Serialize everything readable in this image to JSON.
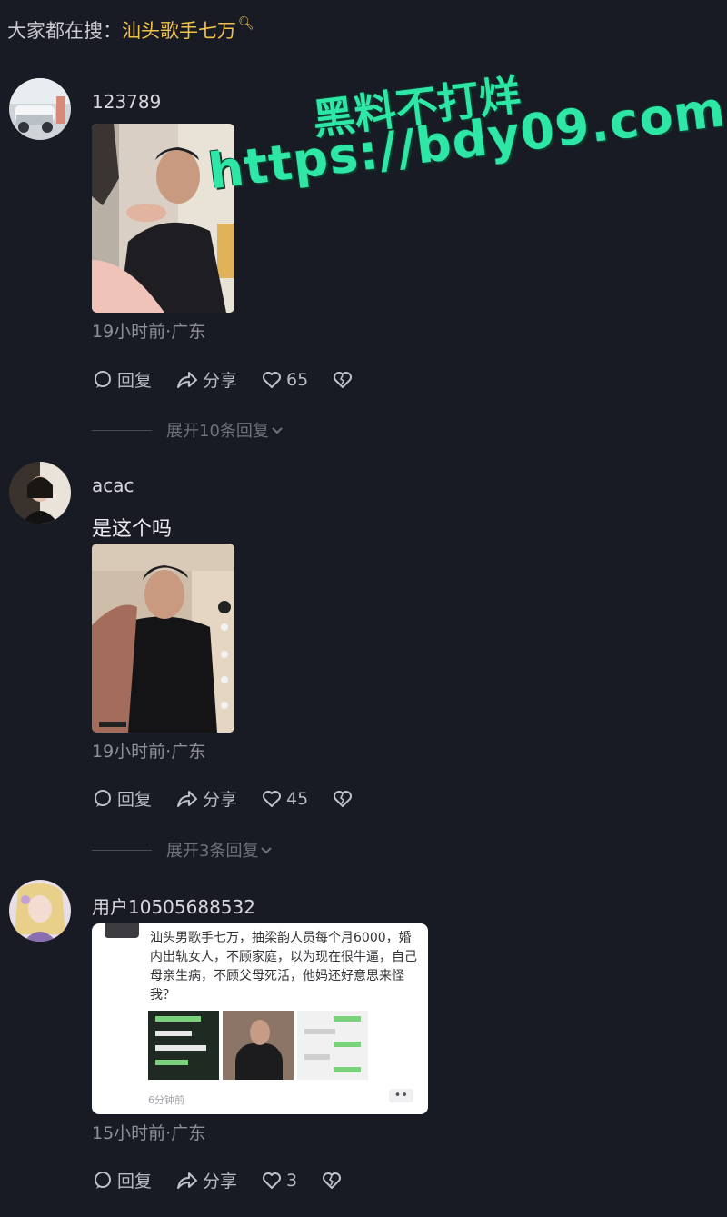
{
  "search": {
    "prefix": "大家都在搜：",
    "term": "汕头歌手七万"
  },
  "watermark": {
    "line1": "黑料不打烊",
    "line2": "https://bdy09.com"
  },
  "actions": {
    "reply": "回复",
    "share": "分享"
  },
  "comments": [
    {
      "username": "123789",
      "text": "",
      "meta": "19小时前·广东",
      "likes": "65",
      "expand": "展开10条回复"
    },
    {
      "username": "acac",
      "text": "是这个吗",
      "meta": "19小时前·广东",
      "likes": "45",
      "expand": "展开3条回复"
    },
    {
      "username": "用户10505688532",
      "text": "",
      "meta": "15小时前·广东",
      "likes": "3",
      "expand": "",
      "card": {
        "text": "汕头男歌手七万，抽梁韵人员每个月6000，婚内出轨女人，不顾家庭，以为现在很牛逼，自己母亲生病，不顾父母死活，他妈还好意思来怪我？",
        "time": "6分钟前",
        "more": "••"
      }
    }
  ]
}
